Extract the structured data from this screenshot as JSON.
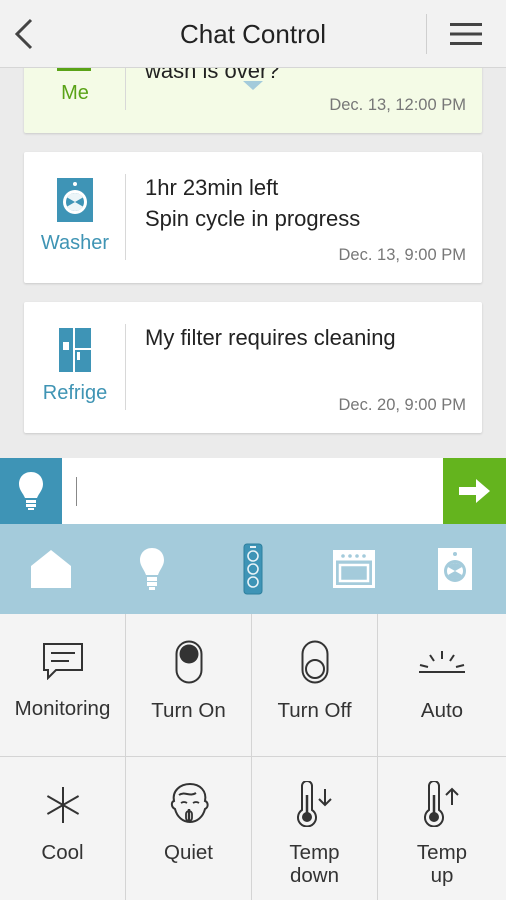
{
  "header": {
    "title": "Chat Control"
  },
  "messages": [
    {
      "sender": "Me",
      "text": "wash is over?",
      "time": "Dec. 13, 12:00 PM"
    },
    {
      "sender": "Washer",
      "text_line1": "1hr 23min left",
      "text_line2": "Spin cycle in progress",
      "time": "Dec. 13, 9:00 PM",
      "icon": "washer-icon"
    },
    {
      "sender": "Refrige",
      "text": "My filter requires cleaning",
      "time": "Dec. 20, 9:00 PM",
      "icon": "refrigerator-icon"
    }
  ],
  "input": {
    "value": "",
    "placeholder": ""
  },
  "devices": [
    "home-icon",
    "light-bulb-icon",
    "air-purifier-icon",
    "oven-icon",
    "washer-icon"
  ],
  "controls": [
    {
      "label": "Monitoring",
      "icon": "monitoring-icon"
    },
    {
      "label": "Turn On",
      "icon": "switch-on-icon"
    },
    {
      "label": "Turn Off",
      "icon": "switch-off-icon"
    },
    {
      "label": "Auto",
      "icon": "auto-icon"
    },
    {
      "label": "Cool",
      "icon": "snowflake-icon"
    },
    {
      "label": "Quiet",
      "icon": "quiet-icon"
    },
    {
      "label_line1": "Temp",
      "label_line2": "down",
      "icon": "temp-down-icon"
    },
    {
      "label_line1": "Temp",
      "label_line2": "up",
      "icon": "temp-up-icon"
    }
  ],
  "colors": {
    "accent_blue": "#3e94b6",
    "accent_green": "#64b41e",
    "device_bar": "#a4cbdb",
    "me_card": "#f4fbe6"
  }
}
